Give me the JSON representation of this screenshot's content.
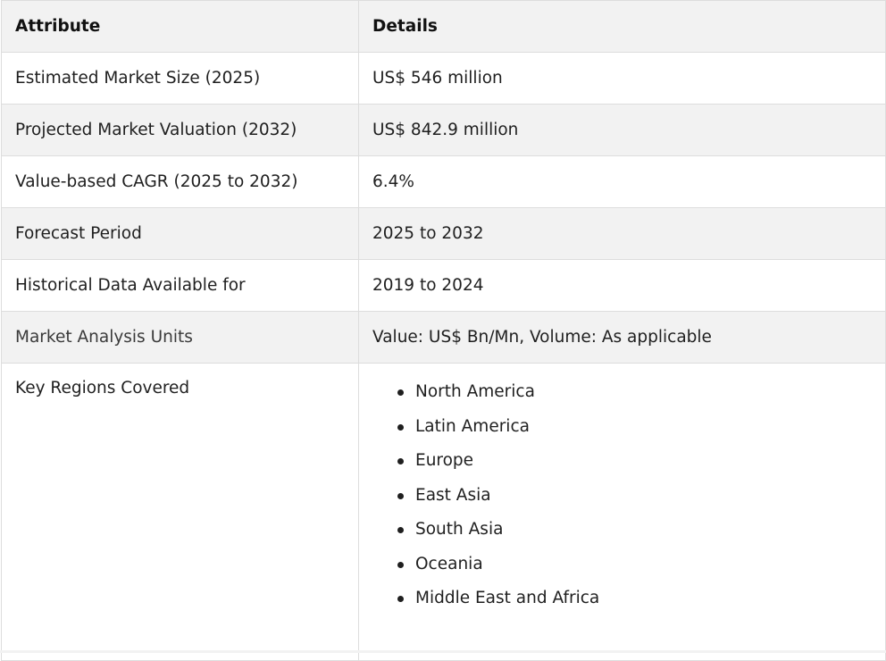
{
  "table": {
    "headers": [
      "Attribute",
      "Details"
    ],
    "rows": [
      {
        "attribute": "Estimated Market Size (2025)",
        "details": "US$ 546 million"
      },
      {
        "attribute": "Projected Market Valuation (2032)",
        "details": "US$ 842.9 million"
      },
      {
        "attribute": "Value-based CAGR (2025 to 2032)",
        "details": "6.4%"
      },
      {
        "attribute": "Forecast Period",
        "details": "2025 to 2032"
      },
      {
        "attribute": "Historical Data Available for",
        "details": "2019 to 2024"
      },
      {
        "attribute": "Market Analysis Units",
        "details": "Value: US$ Bn/Mn, Volume: As applicable"
      }
    ],
    "regions": {
      "attribute": "Key Regions Covered",
      "items": [
        "North America",
        "Latin America",
        "Europe",
        "East Asia",
        "South Asia",
        "Oceania",
        "Middle East and Africa"
      ]
    }
  },
  "colors": {
    "header_bg": "#f2f2f2",
    "alt_row_bg": "#f2f2f2",
    "border": "#dddddd",
    "text": "#1f1f1f"
  }
}
